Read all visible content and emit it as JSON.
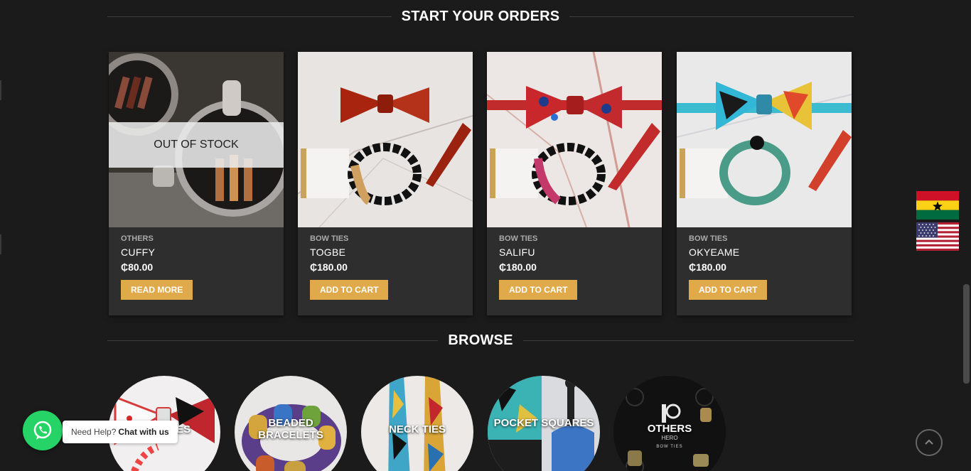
{
  "sections": {
    "orders_title": "START YOUR ORDERS",
    "browse_title": "BROWSE"
  },
  "products": [
    {
      "category": "OTHERS",
      "name": "CUFFY",
      "price": "₵80.00",
      "button": "READ MORE",
      "badge": "OUT OF STOCK"
    },
    {
      "category": "BOW TIES",
      "name": "TOGBE",
      "price": "₵180.00",
      "button": "ADD TO CART"
    },
    {
      "category": "BOW TIES",
      "name": "SALIFU",
      "price": "₵180.00",
      "button": "ADD TO CART"
    },
    {
      "category": "BOW TIES",
      "name": "OKYEAME",
      "price": "₵180.00",
      "button": "ADD TO CART"
    }
  ],
  "browse": [
    {
      "label": "BOW TIES"
    },
    {
      "label": "BEADED BRACELETS"
    },
    {
      "label": "NECK TIES"
    },
    {
      "label": "POCKET SQUARES"
    },
    {
      "label": "OTHERS"
    }
  ],
  "branding": {
    "others_logo_text": "HERO",
    "others_logo_sub": "BOW TIES"
  },
  "whatsapp": {
    "prompt": "Need Help?",
    "cta": "Chat with us"
  },
  "colors": {
    "background": "#1b1b1b",
    "card": "#2e2e2e",
    "accent": "#e0a94a",
    "whatsapp": "#25d366"
  },
  "icons": {
    "whatsapp": "whatsapp-icon",
    "back_to_top": "chevron-up-icon",
    "flag_ghana": "ghana-flag-icon",
    "flag_usa": "usa-flag-icon"
  }
}
